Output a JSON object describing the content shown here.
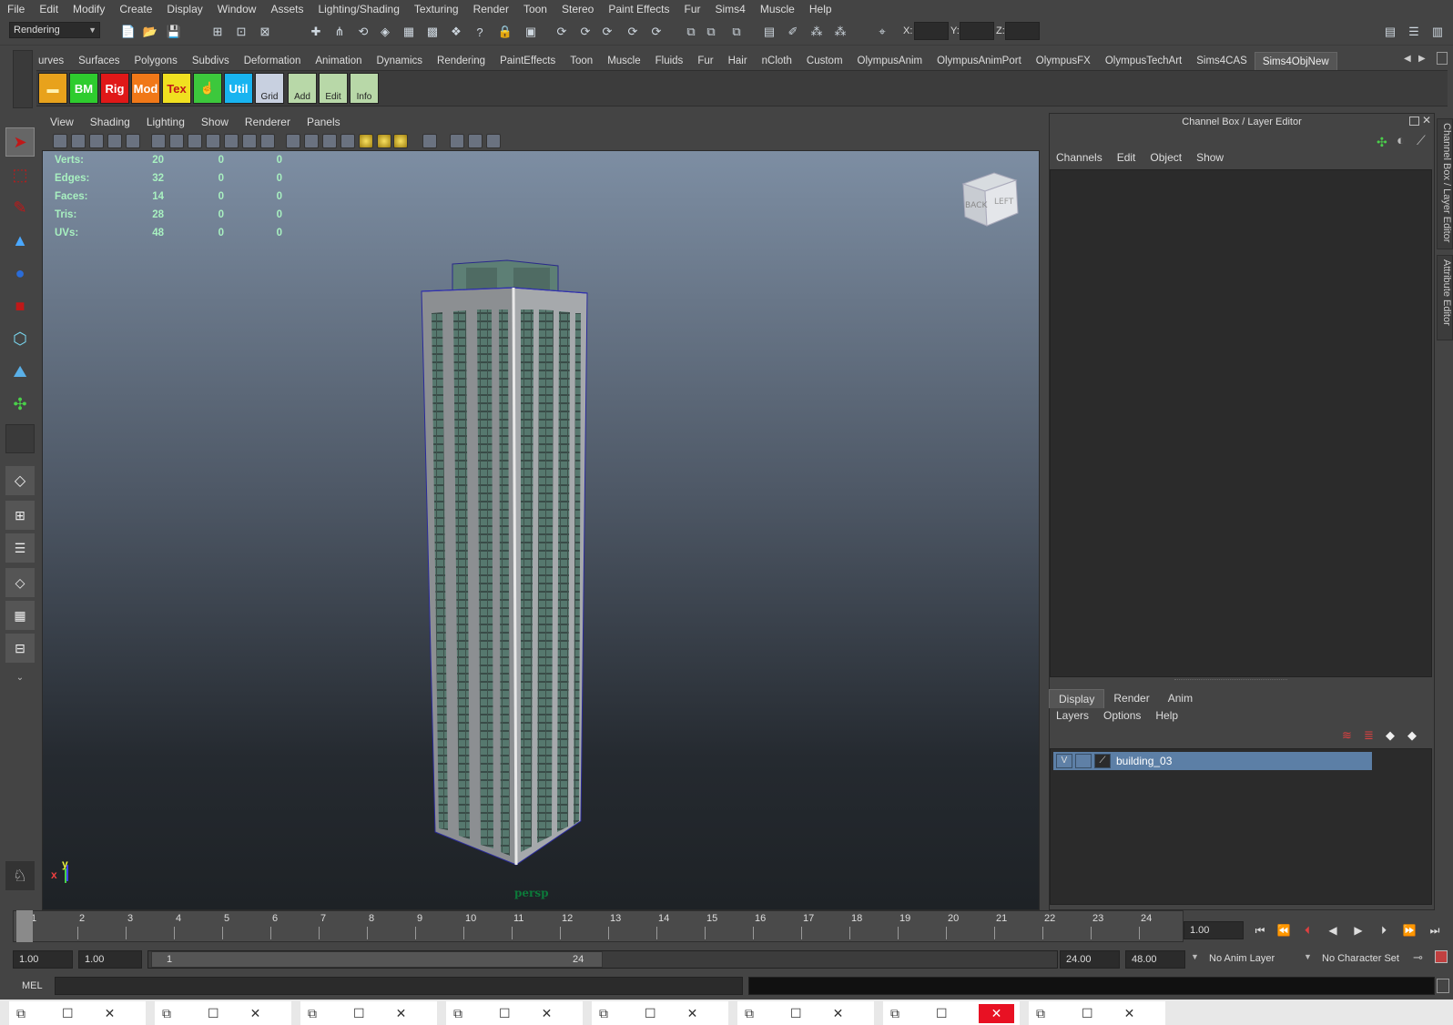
{
  "menubar": [
    "File",
    "Edit",
    "Modify",
    "Create",
    "Display",
    "Window",
    "Assets",
    "Lighting/Shading",
    "Texturing",
    "Render",
    "Toon",
    "Stereo",
    "Paint Effects",
    "Fur",
    "Sims4",
    "Muscle",
    "Help"
  ],
  "status": {
    "mode": "Rendering",
    "x_label": "X:",
    "y_label": "Y:",
    "z_label": "Z:"
  },
  "shelf_tabs": [
    "Curves",
    "Surfaces",
    "Polygons",
    "Subdivs",
    "Deformation",
    "Animation",
    "Dynamics",
    "Rendering",
    "PaintEffects",
    "Toon",
    "Muscle",
    "Fluids",
    "Fur",
    "Hair",
    "nCloth",
    "Custom",
    "OlympusAnim",
    "OlympusAnimPort",
    "OlympusFX",
    "OlympusTechArt",
    "Sims4CAS",
    "Sims4ObjNew"
  ],
  "shelf_tabs_display_first": "urves",
  "shelf_buttons": [
    {
      "label": "",
      "icon": "folder-icon",
      "bg": "#e8a21c"
    },
    {
      "label": "BM",
      "bg": "#2ecc2e",
      "fg": "#ffffff"
    },
    {
      "label": "Rig",
      "bg": "#e01818",
      "fg": "#ffffff"
    },
    {
      "label": "Mod",
      "bg": "#f07818",
      "fg": "#ffffff"
    },
    {
      "label": "Tex",
      "bg": "#f0e020",
      "fg": "#c01818"
    },
    {
      "label": "",
      "icon": "hand-icon",
      "bg": "#3cc83c"
    },
    {
      "label": "Util",
      "bg": "#18b4f0",
      "fg": "#ffffff"
    },
    {
      "label": "Grid",
      "bg": "#c8d0e0"
    },
    {
      "label": "Add",
      "bg": "#b8d8a8"
    },
    {
      "label": "Edit",
      "bg": "#b8d8a8"
    },
    {
      "label": "Info",
      "bg": "#b8d8a8"
    }
  ],
  "viewport_menu": [
    "View",
    "Shading",
    "Lighting",
    "Show",
    "Renderer",
    "Panels"
  ],
  "hud": [
    {
      "label": "Verts:",
      "a": "20",
      "b": "0",
      "c": "0"
    },
    {
      "label": "Edges:",
      "a": "32",
      "b": "0",
      "c": "0"
    },
    {
      "label": "Faces:",
      "a": "14",
      "b": "0",
      "c": "0"
    },
    {
      "label": "Tris:",
      "a": "28",
      "b": "0",
      "c": "0"
    },
    {
      "label": "UVs:",
      "a": "48",
      "b": "0",
      "c": "0"
    }
  ],
  "viewcube": {
    "back": "BACK",
    "left": "LEFT"
  },
  "camera_name": "persp",
  "axis": {
    "x": "x",
    "y": "y"
  },
  "channel_box": {
    "title": "Channel Box / Layer Editor",
    "menu": [
      "Channels",
      "Edit",
      "Object",
      "Show"
    ]
  },
  "layer_editor": {
    "tabs": [
      "Display",
      "Render",
      "Anim"
    ],
    "menu": [
      "Layers",
      "Options",
      "Help"
    ],
    "layer": {
      "visible": "V",
      "name": "building_03"
    }
  },
  "side_tabs": [
    "Channel Box / Layer Editor",
    "Attribute Editor"
  ],
  "timeline": {
    "ticks": [
      "1",
      "2",
      "3",
      "4",
      "5",
      "6",
      "7",
      "8",
      "9",
      "10",
      "11",
      "12",
      "13",
      "14",
      "15",
      "16",
      "17",
      "18",
      "19",
      "20",
      "21",
      "22",
      "23",
      "24"
    ],
    "current_frame": "1.00"
  },
  "range": {
    "start": "1.00",
    "start2": "1.00",
    "inner_start": "1",
    "inner_end": "24",
    "end": "24.00",
    "end2": "48.00",
    "anim_layer": "No Anim Layer",
    "char_set": "No Character Set"
  },
  "command": {
    "label": "MEL"
  }
}
